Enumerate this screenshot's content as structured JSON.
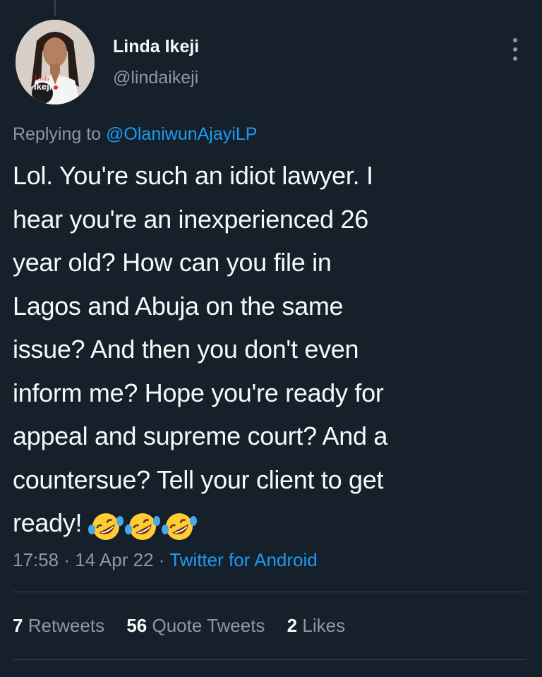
{
  "tweet": {
    "author": {
      "display_name": "Linda Ikeji",
      "handle": "@lindaikeji",
      "avatar_badge_text": "Linda Ikeji TV"
    },
    "reply": {
      "prefix": "Replying to",
      "to_handle": "@OlaniwunAjayiLP"
    },
    "text_lines": [
      "Lol. You're such an idiot lawyer. I",
      "hear you're an inexperienced 26",
      "year old? How can you file in",
      "Lagos and Abuja on the same",
      "issue? And then you don't even",
      "inform me? Hope you're ready for",
      "appeal and supreme court? And a",
      "countersue? Tell your client to get",
      "ready!"
    ],
    "emojis": [
      "rolling-on-floor-laughing",
      "rolling-on-floor-laughing",
      "rolling-on-floor-laughing"
    ],
    "meta": {
      "time": "17:58",
      "separator": "·",
      "date": "14 Apr 22",
      "source": "Twitter for Android"
    },
    "stats": {
      "retweets_count": "7",
      "retweets_label": "Retweets",
      "quotes_count": "56",
      "quotes_label": "Quote Tweets",
      "likes_count": "2",
      "likes_label": "Likes"
    }
  },
  "colors": {
    "background": "#15202b",
    "text_primary": "#f7f9f9",
    "text_secondary": "#8b98a5",
    "link_blue": "#1d9bf0",
    "divider": "#38444d"
  },
  "icons": {
    "more": "more-dots-vertical-icon"
  }
}
